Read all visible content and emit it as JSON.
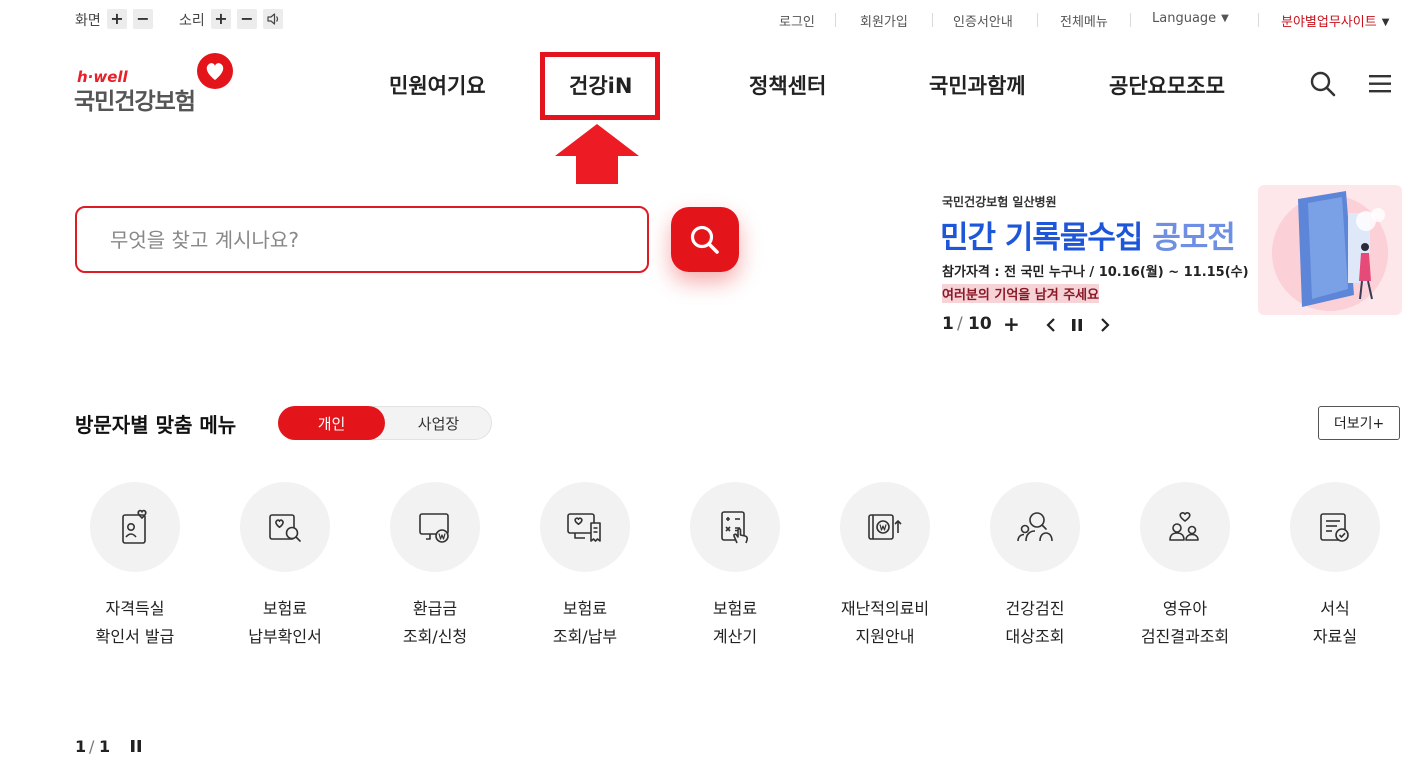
{
  "utility": {
    "screen_label": "화면",
    "sound_label": "소리",
    "plus": "+",
    "minus": "−",
    "links": {
      "login": "로그인",
      "signup": "회원가입",
      "cert": "인증서안내",
      "all_menu": "전체메뉴",
      "language": "Language",
      "field_sites": "분야별업무사이트"
    }
  },
  "logo": {
    "small": "h·well",
    "main": "국민건강보험"
  },
  "nav": [
    "민원여기요",
    "건강iN",
    "정책센터",
    "국민과함께",
    "공단요모조모"
  ],
  "search": {
    "placeholder": "무엇을 찾고 계시나요?"
  },
  "banner": {
    "org": "국민건강보험 일산병원",
    "title_blue": "민간 기록물수집",
    "title_light": "공모전",
    "eligibility": "참가자격 : 전 국민 누구나 / 10.16(월) ~ 11.15(수)",
    "tagline": "여러분의 기억을 남겨 주세요",
    "page_current": "1",
    "page_sep": "/",
    "page_total": "10",
    "plus": "+"
  },
  "visitor_menu": {
    "title": "방문자별 맞춤 메뉴",
    "tabs": [
      "개인",
      "사업장"
    ],
    "more": "더보기+",
    "items": [
      {
        "line1": "자격득실",
        "line2": "확인서 발급",
        "icon": "id-card-heart-icon"
      },
      {
        "line1": "보험료",
        "line2": "납부확인서",
        "icon": "document-search-icon"
      },
      {
        "line1": "환급금",
        "line2": "조회/신청",
        "icon": "monitor-won-icon"
      },
      {
        "line1": "보험료",
        "line2": "조회/납부",
        "icon": "monitor-receipt-icon"
      },
      {
        "line1": "보험료",
        "line2": "계산기",
        "icon": "calculator-hand-icon"
      },
      {
        "line1": "재난적의료비",
        "line2": "지원안내",
        "icon": "wallet-won-icon"
      },
      {
        "line1": "건강검진",
        "line2": "대상조회",
        "icon": "people-search-icon"
      },
      {
        "line1": "영유아",
        "line2": "검진결과조회",
        "icon": "parent-child-heart-icon"
      },
      {
        "line1": "서식",
        "line2": "자료실",
        "icon": "form-check-icon"
      }
    ],
    "pager_current": "1",
    "pager_sep": "/",
    "pager_total": "1"
  },
  "colors": {
    "brand_red": "#e4141b",
    "banner_blue": "#1e56d9",
    "field_sites_red": "#c8101a"
  }
}
